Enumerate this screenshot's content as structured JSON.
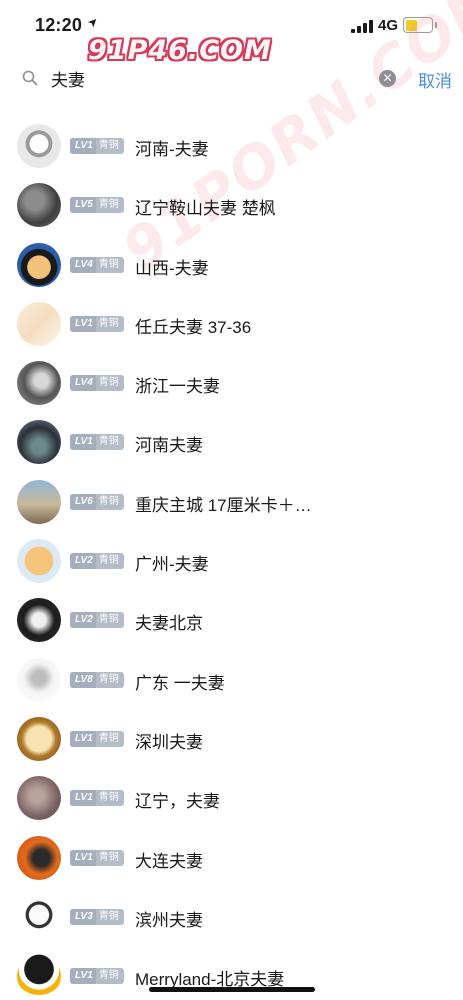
{
  "status_bar": {
    "time": "12:20",
    "network": "4G",
    "battery_color": "#f1cc28"
  },
  "watermark": {
    "top": "91P46.COM",
    "diagonal": "91PORN.COM"
  },
  "search": {
    "query": "夫妻",
    "cancel_label": "取消"
  },
  "badge_rank": "青铜",
  "users": [
    {
      "level": "LV1",
      "name": "河南-夫妻",
      "avatar_icon": "sketch-face-avatar"
    },
    {
      "level": "LV5",
      "name": "辽宁鞍山夫妻 楚枫",
      "avatar_icon": "dark-photo-avatar"
    },
    {
      "level": "LV4",
      "name": "山西-夫妻",
      "avatar_icon": "cartoon-face-avatar"
    },
    {
      "level": "LV1",
      "name": "任丘夫妻 37-36",
      "avatar_icon": "legs-photo-avatar"
    },
    {
      "level": "LV4",
      "name": "浙江一夫妻",
      "avatar_icon": "man-photo-avatar"
    },
    {
      "level": "LV1",
      "name": "河南夫妻",
      "avatar_icon": "watch-photo-avatar"
    },
    {
      "level": "LV6",
      "name": "重庆主城 17厘米卡＋…",
      "avatar_icon": "beach-photo-avatar"
    },
    {
      "level": "LV2",
      "name": "广州-夫妻",
      "avatar_icon": "bald-cartoon-avatar"
    },
    {
      "level": "LV2",
      "name": "夫妻北京",
      "avatar_icon": "hand-gesture-avatar"
    },
    {
      "level": "LV8",
      "name": "广东 一夫妻",
      "avatar_icon": "bw-photo-avatar"
    },
    {
      "level": "LV1",
      "name": "深圳夫妻",
      "avatar_icon": "clock-avatar"
    },
    {
      "level": "LV1",
      "name": "辽宁，夫妻",
      "avatar_icon": "muted-photo-avatar"
    },
    {
      "level": "LV1",
      "name": "大连夫妻",
      "avatar_icon": "orange-car-avatar"
    },
    {
      "level": "LV3",
      "name": "滨州夫妻",
      "avatar_icon": "meme-face-avatar"
    },
    {
      "level": "LV1",
      "name": "Merryland-北京夫妻",
      "avatar_icon": "penguin-avatar"
    }
  ]
}
